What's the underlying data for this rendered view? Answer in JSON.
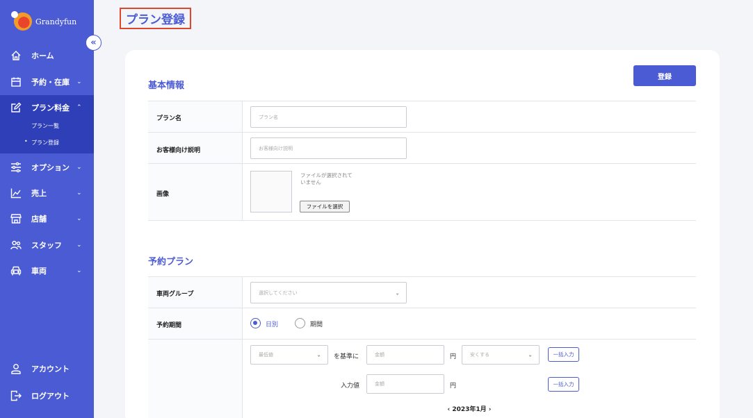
{
  "app": {
    "name": "Grandyfun"
  },
  "page": {
    "title": "プラン登録"
  },
  "sidebar": {
    "collapse_icon": "«",
    "items": [
      {
        "label": "ホーム",
        "icon": "home-icon"
      },
      {
        "label": "予約・在庫",
        "icon": "calendar-icon",
        "chevron": "⌄"
      },
      {
        "label": "プラン料金",
        "icon": "edit-icon",
        "chevron": "⌃"
      },
      {
        "label": "オプション",
        "icon": "sliders-icon",
        "chevron": "⌄"
      },
      {
        "label": "売上",
        "icon": "chart-icon",
        "chevron": "⌄"
      },
      {
        "label": "店舗",
        "icon": "store-icon",
        "chevron": "⌄"
      },
      {
        "label": "スタッフ",
        "icon": "staff-icon",
        "chevron": "⌄"
      },
      {
        "label": "車両",
        "icon": "car-icon",
        "chevron": "⌄"
      }
    ],
    "sub_items": [
      {
        "label": "プラン一覧"
      },
      {
        "label": "プラン登録",
        "bullet": "•"
      }
    ],
    "footer": [
      {
        "label": "アカウント",
        "icon": "user-icon"
      },
      {
        "label": "ログアウト",
        "icon": "logout-icon"
      }
    ]
  },
  "actions": {
    "register_label": "登録"
  },
  "basic_info": {
    "title": "基本情報",
    "plan_name_label": "プラン名",
    "plan_name_placeholder": "プラン名",
    "description_label": "お客様向け説明",
    "description_placeholder": "お客様向け説明",
    "image_label": "画像",
    "file_status": "ファイルが選択されていません",
    "file_button": "ファイルを選択"
  },
  "reservation": {
    "title": "予約プラン",
    "vehicle_group_label": "車両グループ",
    "vehicle_group_placeholder": "選択してください",
    "period_label": "予約期間",
    "radio_daily": "日別",
    "radio_period": "期間",
    "price_base_select": "最低値",
    "base_text": "を基準に",
    "amount_placeholder": "金額",
    "yen": "円",
    "adjust_select": "安くする",
    "bulk_input_label": "一括入力",
    "input_value_label": "入力値",
    "month_label": "2023年1月",
    "prev_month": "‹",
    "next_month": "›"
  },
  "colors": {
    "brand": "#4a5bd3",
    "sidebar_active": "#2f3fb7",
    "title_highlight": "#e0452e"
  }
}
